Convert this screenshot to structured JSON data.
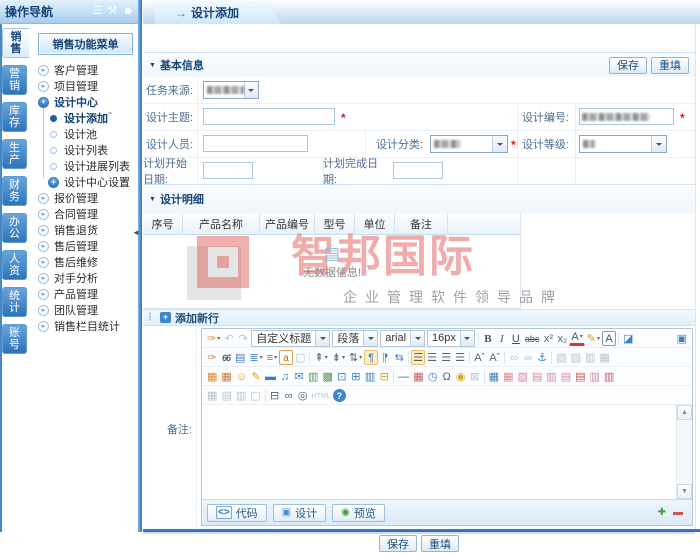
{
  "left_panel": {
    "title": "操作导航",
    "header_icons": [
      {
        "n": "list-icon",
        "g": "☰"
      },
      {
        "n": "wrench-icon",
        "g": "⚒"
      },
      {
        "n": "user-icon",
        "g": "☻"
      }
    ],
    "tabs": [
      {
        "label": "销售",
        "cls": "active"
      },
      {
        "label": "营销"
      },
      {
        "label": "库存"
      },
      {
        "label": "生产"
      },
      {
        "label": "财务"
      },
      {
        "label": "办公"
      },
      {
        "label": "人资"
      },
      {
        "label": "统计"
      },
      {
        "label": "账号"
      }
    ],
    "menu_button": "销售功能菜单",
    "tree": [
      {
        "label": "客户管理",
        "cls": "t-arrow"
      },
      {
        "label": "项目管理",
        "cls": "t-arrow"
      },
      {
        "label": "设计中心",
        "cls": "t-open"
      },
      {
        "label": "设计添加",
        "cls": "t-active sub"
      },
      {
        "label": "设计池",
        "cls": "t-dot sub"
      },
      {
        "label": "设计列表",
        "cls": "t-dot sub"
      },
      {
        "label": "设计进展列表",
        "cls": "t-dot sub"
      },
      {
        "label": "设计中心设置",
        "cls": "t-plus sub"
      },
      {
        "label": "报价管理",
        "cls": "t-arrow"
      },
      {
        "label": "合同管理",
        "cls": "t-arrow"
      },
      {
        "label": "销售退货",
        "cls": "t-arrow"
      },
      {
        "label": "售后管理",
        "cls": "t-arrow"
      },
      {
        "label": "售后维修",
        "cls": "t-arrow"
      },
      {
        "label": "对手分析",
        "cls": "t-arrow"
      },
      {
        "label": "产品管理",
        "cls": "t-arrow"
      },
      {
        "label": "团队管理",
        "cls": "t-arrow"
      },
      {
        "label": "销售栏目统计",
        "cls": "t-arrow"
      }
    ]
  },
  "main": {
    "tab": "设计添加",
    "tab_icon_glyph": "→",
    "add_icon_glyph": "+",
    "buttons": {
      "save": "保存",
      "reset": "重填"
    },
    "sections": {
      "basic": "基本信息",
      "detail": "设计明细",
      "add_row": "添加新行"
    },
    "form": {
      "task_source": "任务来源:",
      "subject": "设计主题:",
      "design_no": "设计编号:",
      "designer": "设计人员:",
      "category": "设计分类:",
      "grade": "设计等级:",
      "plan_start": "计划开始日期:",
      "plan_end": "计划完成日期:",
      "required": "*"
    },
    "detail_table": {
      "headers": [
        "序号",
        "产品名称",
        "产品编号",
        "型号",
        "单位",
        "备注",
        ""
      ],
      "empty_icon": "▤",
      "empty_text": "无数据信息!"
    },
    "watermark": {
      "brand": "智邦国际",
      "slogan": "企业管理软件领导品牌"
    },
    "editor": {
      "note_label": "备注:",
      "selects": [
        {
          "n": "style-select",
          "v": "自定义标题"
        },
        {
          "n": "paragraph-select",
          "v": "段落"
        },
        {
          "n": "font-select",
          "v": "arial"
        },
        {
          "n": "size-select",
          "v": "16px"
        }
      ],
      "row1a": [
        {
          "n": "quick-style-icon",
          "g": "✑",
          "c": "c-orange dd"
        },
        {
          "n": "undo-icon",
          "g": "↶",
          "c": "c-dis"
        },
        {
          "n": "redo-icon",
          "g": "↷",
          "c": "c-dis"
        }
      ],
      "row1b": [
        {
          "c": "sep"
        },
        {
          "n": "bold-button",
          "g": "B",
          "c": "c-b"
        },
        {
          "n": "italic-button",
          "g": "I",
          "c": "c-i"
        },
        {
          "n": "underline-button",
          "g": "U",
          "c": "c-u"
        },
        {
          "n": "strikethrough-button",
          "g": "abc",
          "c": "c-strike"
        },
        {
          "n": "superscript-button",
          "g": "x²",
          "c": "c-dark"
        },
        {
          "n": "subscript-button",
          "g": "x₂",
          "c": "c-dark"
        },
        {
          "n": "font-color-button",
          "g": "A",
          "c": "c-fc dd"
        },
        {
          "n": "highlight-color-button",
          "g": "✎",
          "c": "c-gold dd"
        },
        {
          "n": "border-button",
          "g": "A",
          "c": "c-box"
        },
        {
          "c": "sep"
        },
        {
          "n": "eraser-button",
          "g": "◪",
          "c": "c-blue"
        },
        {
          "n": "fullscreen-button",
          "g": "▣",
          "c": "c-blue right"
        }
      ],
      "row2": [
        {
          "n": "format-painter-icon",
          "g": "✑",
          "c": "c-orange2"
        },
        {
          "n": "blockquote-icon",
          "g": "66",
          "c": "c-quote"
        },
        {
          "n": "paste-word-icon",
          "g": "▤",
          "c": "c-blue"
        },
        {
          "n": "ordered-list-icon",
          "g": "≣",
          "c": "c-blue dd"
        },
        {
          "n": "unordered-list-icon",
          "g": "≡",
          "c": "c-blue dd"
        },
        {
          "n": "lowercase-icon",
          "g": "a",
          "c": "c-box-sm"
        },
        {
          "n": "new-page-icon",
          "g": "▢",
          "c": "c-dis"
        },
        {
          "c": "sep"
        },
        {
          "n": "margin-top-icon",
          "g": "⇞",
          "c": "c-dark dd"
        },
        {
          "n": "margin-bottom-icon",
          "g": "⇟",
          "c": "c-dark dd"
        },
        {
          "n": "line-height-icon",
          "g": "⇅",
          "c": "c-dark dd"
        },
        {
          "n": "ltr-icon",
          "g": "¶",
          "c": "c-blue hl"
        },
        {
          "n": "rtl-icon",
          "g": "¶",
          "c": "c-blue flip"
        },
        {
          "n": "word-wrap-icon",
          "g": "⇆",
          "c": "c-blue"
        },
        {
          "c": "sep"
        },
        {
          "n": "align-left-icon",
          "g": "☰",
          "c": "c-dark hl"
        },
        {
          "n": "align-center-icon",
          "g": "☰",
          "c": "c-dark"
        },
        {
          "n": "align-right-icon",
          "g": "☰",
          "c": "c-dark"
        },
        {
          "n": "align-justify-icon",
          "g": "☰",
          "c": "c-dark"
        },
        {
          "c": "sep"
        },
        {
          "n": "letter-spacing-increase-icon",
          "g": "Aˆ",
          "c": "c-dark"
        },
        {
          "n": "letter-spacing-decrease-icon",
          "g": "Aˇ",
          "c": "c-dark"
        },
        {
          "c": "sep"
        },
        {
          "n": "link-icon",
          "g": "∞",
          "c": "c-dis"
        },
        {
          "n": "unlink-icon",
          "g": "∞",
          "c": "c-dis"
        },
        {
          "n": "anchor-icon",
          "g": "⚓",
          "c": "c-blue"
        },
        {
          "c": "sep"
        },
        {
          "n": "image-align-left-icon",
          "g": "▧",
          "c": "c-dis"
        },
        {
          "n": "image-align-right-icon",
          "g": "▨",
          "c": "c-dis"
        },
        {
          "n": "image-inline-icon",
          "g": "▥",
          "c": "c-dis"
        },
        {
          "n": "image-block-icon",
          "g": "▦",
          "c": "c-dis"
        }
      ],
      "row3": [
        {
          "n": "image-icon",
          "g": "▦",
          "c": "c-orange"
        },
        {
          "n": "image-upload-icon",
          "g": "▦",
          "c": "c-orange2"
        },
        {
          "n": "emoticon-icon",
          "g": "☺",
          "c": "c-gold"
        },
        {
          "n": "pencil-icon",
          "g": "✎",
          "c": "c-gold"
        },
        {
          "n": "flash-icon",
          "g": "▬",
          "c": "c-blue"
        },
        {
          "n": "media-icon",
          "g": "♫",
          "c": "c-blue"
        },
        {
          "n": "attachment-icon",
          "g": "✉",
          "c": "c-blue"
        },
        {
          "n": "chart-icon",
          "g": "▥",
          "c": "c-green"
        },
        {
          "n": "gallery-icon",
          "g": "▩",
          "c": "c-green"
        },
        {
          "n": "insert-file-icon",
          "g": "⊡",
          "c": "c-blue"
        },
        {
          "n": "org-chart-icon",
          "g": "⊞",
          "c": "c-blue"
        },
        {
          "n": "columns-icon",
          "g": "▥",
          "c": "c-blue"
        },
        {
          "n": "browse-folder-icon",
          "g": "⊟",
          "c": "c-gold"
        },
        {
          "c": "sep"
        },
        {
          "n": "horizontal-rule-icon",
          "g": "—",
          "c": "c-dark"
        },
        {
          "n": "calendar-icon",
          "g": "▦",
          "c": "c-red"
        },
        {
          "n": "clock-icon",
          "g": "◷",
          "c": "c-blue"
        },
        {
          "n": "special-char-icon",
          "g": "Ω",
          "c": "c-dark"
        },
        {
          "n": "map-icon",
          "g": "◉",
          "c": "c-gold"
        },
        {
          "n": "screenshot-icon",
          "g": "⊠",
          "c": "c-dis"
        },
        {
          "c": "sep"
        },
        {
          "n": "insert-table-icon",
          "g": "▦",
          "c": "c-blue"
        },
        {
          "n": "table-properties-icon",
          "g": "▦",
          "c": "c-pink"
        },
        {
          "n": "cell-properties-icon",
          "g": "▧",
          "c": "c-pink"
        },
        {
          "n": "merge-cells-icon",
          "g": "▤",
          "c": "c-pink"
        },
        {
          "n": "split-cells-icon",
          "g": "▥",
          "c": "c-pink"
        },
        {
          "n": "insert-row-icon",
          "g": "▤",
          "c": "c-pink"
        },
        {
          "n": "delete-row-icon",
          "g": "▤",
          "c": "c-red"
        },
        {
          "n": "insert-column-icon",
          "g": "▥",
          "c": "c-pink"
        },
        {
          "n": "delete-column-icon",
          "g": "▥",
          "c": "c-red"
        }
      ],
      "row4": [
        {
          "n": "delete-table-icon",
          "g": "▦",
          "c": "c-dis"
        },
        {
          "n": "table-sort-icon",
          "g": "▤",
          "c": "c-dis"
        },
        {
          "n": "table-grid-icon",
          "g": "▥",
          "c": "c-dis"
        },
        {
          "n": "page-template-icon",
          "g": "▢",
          "c": "c-dis"
        },
        {
          "c": "sep"
        },
        {
          "n": "print-icon",
          "g": "⊟",
          "c": "c-dark"
        },
        {
          "n": "find-icon",
          "g": "∞",
          "c": "c-dark"
        },
        {
          "n": "zoom-icon",
          "g": "◎",
          "c": "c-dark"
        },
        {
          "n": "html-source-icon",
          "g": "HTML",
          "c": "c-dis c-tiny"
        },
        {
          "n": "help-icon",
          "g": "?",
          "c": "c-help"
        }
      ],
      "bottom_tabs": [
        {
          "n": "code-view-tab",
          "icon": "<>",
          "icls": "ico-code",
          "label": "代码"
        },
        {
          "n": "design-view-tab",
          "icon": "▣",
          "icls": "ico-design",
          "label": "设计"
        },
        {
          "n": "preview-tab",
          "icon": "◉",
          "icls": "ico-preview",
          "label": "预览"
        }
      ],
      "zoom_plus": "✚",
      "zoom_minus": "▬"
    }
  }
}
